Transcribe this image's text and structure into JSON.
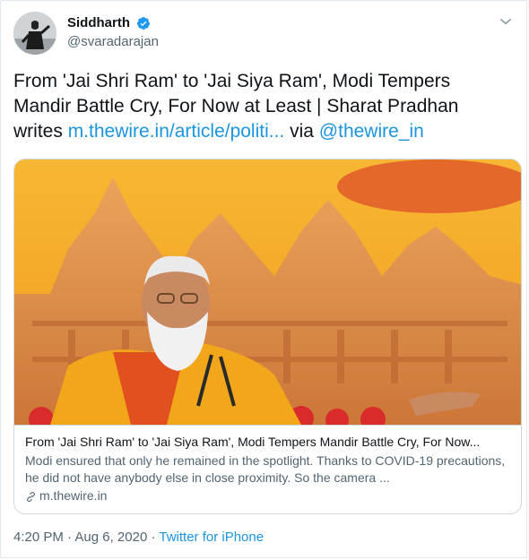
{
  "author": {
    "name": "Siddharth",
    "handle": "@svaradarajan",
    "verified": true
  },
  "tweet": {
    "text_prefix": "From 'Jai Shri Ram' to 'Jai Siya Ram', Modi Tempers Mandir Battle Cry, For Now at Least | Sharat Pradhan writes ",
    "link_text": "m.thewire.in/article/politi...",
    "via_text": " via ",
    "mention": "@thewire_in"
  },
  "card": {
    "title": "From 'Jai Shri Ram' to 'Jai Siya Ram', Modi Tempers Mandir Battle Cry, For Now...",
    "description": "Modi ensured that only he remained in the spotlight. Thanks to COVID-19 precautions, he did not have anybody else in close proximity. So the camera ...",
    "domain": "m.thewire.in"
  },
  "meta": {
    "time": "4:20 PM",
    "separator": " · ",
    "date": "Aug 6, 2020",
    "separator2": " · ",
    "source": "Twitter for iPhone"
  },
  "colors": {
    "link": "#1b95e0",
    "verified_badge": "#1d9bf0",
    "secondary_text": "#536471"
  },
  "icons": {
    "verified": "verified-badge-icon",
    "caret": "chevron-down-icon",
    "link": "link-icon"
  }
}
